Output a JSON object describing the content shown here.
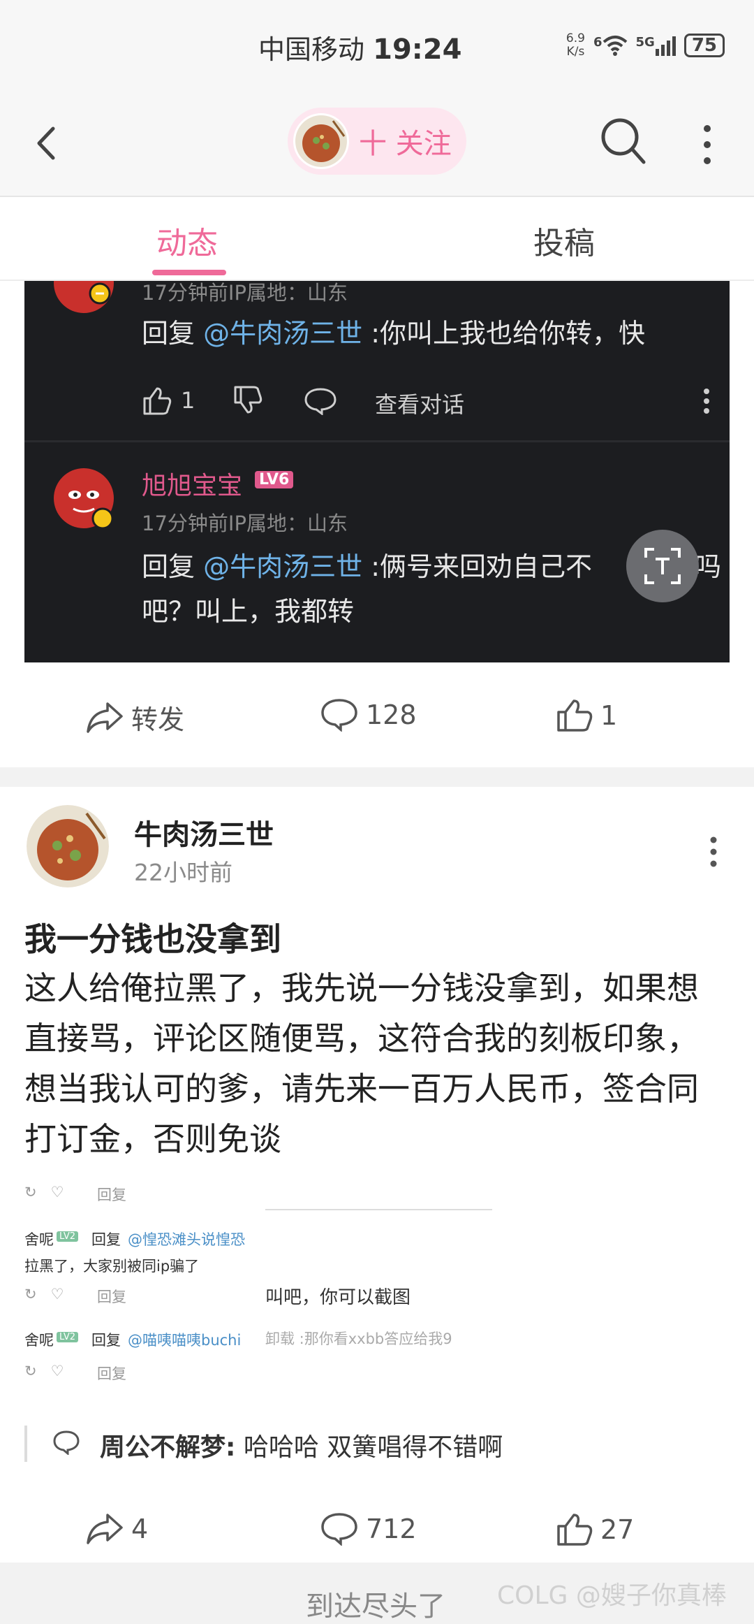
{
  "status_bar": {
    "carrier": "中国移动",
    "time": "19:24",
    "net_speed_value": "6.9",
    "net_speed_unit": "K/s",
    "wifi_sub": "6",
    "cell_label": "5G",
    "battery": "75"
  },
  "header": {
    "follow_label": "十 关注"
  },
  "tabs": [
    {
      "label": "动态",
      "active": true
    },
    {
      "label": "投稿",
      "active": false
    }
  ],
  "dark_card": {
    "top_reply": {
      "meta": "17分钟前IP属地：山东",
      "prefix": "回复 ",
      "mention": "@牛肉汤三世",
      "text": " :你叫上我也给你转，快",
      "like_count": "1",
      "view_dialog": "查看对话"
    },
    "second_reply": {
      "author": "旭旭宝宝",
      "level": "LV6",
      "meta": "17分钟前IP属地：山东",
      "prefix": "回复 ",
      "mention": "@牛肉汤三世",
      "text_line1": " :俩号来回劝自己不",
      "text_line1_tail": "吗",
      "text_line2": "吧？叫上，我都转"
    }
  },
  "post1_actions": {
    "share": "转发",
    "comments": "128",
    "likes": "1"
  },
  "post2": {
    "author": "牛肉汤三世",
    "time": "22小时前",
    "title": "我一分钱也没拿到",
    "body": "这人给俺拉黑了，我先说一分钱没拿到，如果想直接骂，评论区随便骂，这符合我的刻板印象，想当我认可的爹，请先来一百万人民币，签合同打订金，否则免谈",
    "collage": {
      "reply_label": "回复",
      "row1_user": "舍呢",
      "row1_mention": "@惶恐滩头说惶恐",
      "row1_line2": "拉黑了，大家别被同ip骗了",
      "row2_user": "舍呢",
      "row2_mention": "@喵咦喵咦buchi",
      "lv": "LV2",
      "right_line1": "叫吧，你可以截图",
      "right_line2": "卸载 :那你看xxbb答应给我9"
    },
    "hot_comment": {
      "author": "周公不解梦:",
      "text": " 哈哈哈 双簧唱得不错啊"
    },
    "actions": {
      "share": "4",
      "comments": "712",
      "likes": "27"
    }
  },
  "footer": {
    "end_text": "到达尽头了",
    "watermark": "COLG @嫂子你真棒"
  },
  "colors": {
    "accent": "#ef6a99",
    "mention": "#6fb3e8",
    "dark_bg": "#1c1d20"
  }
}
